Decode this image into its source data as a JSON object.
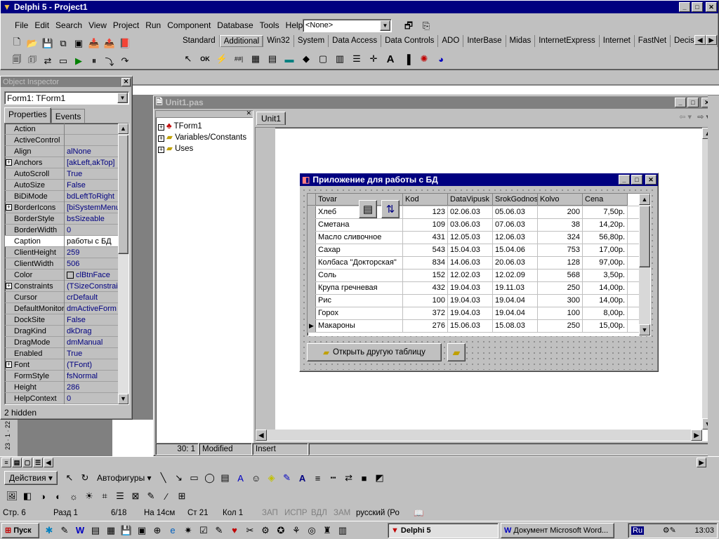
{
  "delphi": {
    "title": "Delphi 5 - Project1",
    "menu": [
      "File",
      "Edit",
      "Search",
      "View",
      "Project",
      "Run",
      "Component",
      "Database",
      "Tools",
      "Help"
    ],
    "desktop_combo": "<None>",
    "palette_tabs": [
      "Standard",
      "Additional",
      "Win32",
      "System",
      "Data Access",
      "Data Controls",
      "ADO",
      "InterBase",
      "Midas",
      "InternetExpress",
      "Internet",
      "FastNet",
      "Decision C"
    ]
  },
  "object_inspector": {
    "title": "Object Inspector",
    "object": "Form1: TForm1",
    "tabs": [
      "Properties",
      "Events"
    ],
    "rows": [
      {
        "name": "Action",
        "value": "",
        "plus": false
      },
      {
        "name": "ActiveControl",
        "value": "",
        "plus": false
      },
      {
        "name": "Align",
        "value": "alNone",
        "plus": false
      },
      {
        "name": "Anchors",
        "value": "[akLeft,akTop]",
        "plus": true
      },
      {
        "name": "AutoScroll",
        "value": "True",
        "plus": false
      },
      {
        "name": "AutoSize",
        "value": "False",
        "plus": false
      },
      {
        "name": "BiDiMode",
        "value": "bdLeftToRight",
        "plus": false
      },
      {
        "name": "BorderIcons",
        "value": "[biSystemMenu,",
        "plus": true
      },
      {
        "name": "BorderStyle",
        "value": "bsSizeable",
        "plus": false
      },
      {
        "name": "BorderWidth",
        "value": "0",
        "plus": false
      },
      {
        "name": "Caption",
        "value": "работы с БД",
        "plus": false,
        "selected": true
      },
      {
        "name": "ClientHeight",
        "value": "259",
        "plus": false
      },
      {
        "name": "ClientWidth",
        "value": "506",
        "plus": false
      },
      {
        "name": "Color",
        "value": "clBtnFace",
        "plus": false
      },
      {
        "name": "Constraints",
        "value": "(TSizeConstrain",
        "plus": true
      },
      {
        "name": "Cursor",
        "value": "crDefault",
        "plus": false
      },
      {
        "name": "DefaultMonitor",
        "value": "dmActiveForm",
        "plus": false
      },
      {
        "name": "DockSite",
        "value": "False",
        "plus": false
      },
      {
        "name": "DragKind",
        "value": "dkDrag",
        "plus": false
      },
      {
        "name": "DragMode",
        "value": "dmManual",
        "plus": false
      },
      {
        "name": "Enabled",
        "value": "True",
        "plus": false
      },
      {
        "name": "Font",
        "value": "(TFont)",
        "plus": true
      },
      {
        "name": "FormStyle",
        "value": "fsNormal",
        "plus": false
      },
      {
        "name": "Height",
        "value": "286",
        "plus": false
      },
      {
        "name": "HelpContext",
        "value": "0",
        "plus": false
      }
    ],
    "status": "2 hidden"
  },
  "editor": {
    "title": "Unit1.pas",
    "tab": "Unit1",
    "tree": [
      "TForm1",
      "Variables/Constants",
      "Uses"
    ],
    "pos": "30:   1",
    "modified": "Modified",
    "insert": "Insert"
  },
  "form": {
    "title": "Приложение для работы с БД",
    "columns": [
      "Tovar",
      "Kod",
      "DataVipusk",
      "SrokGodnos",
      "Kolvo",
      "Cena"
    ],
    "rows": [
      [
        "Хлеб",
        "123",
        "02.06.03",
        "05.06.03",
        "200",
        "7,50р."
      ],
      [
        "Сметана",
        "109",
        "03.06.03",
        "07.06.03",
        "38",
        "14,20р."
      ],
      [
        "Масло сливочное",
        "431",
        "12.05.03",
        "12.06.03",
        "324",
        "56,80р."
      ],
      [
        "Сахар",
        "543",
        "15.04.03",
        "15.04.06",
        "753",
        "17,00р."
      ],
      [
        "Колбаса \"Докторская\"",
        "834",
        "14.06.03",
        "20.06.03",
        "128",
        "97,00р."
      ],
      [
        "Соль",
        "152",
        "12.02.03",
        "12.02.09",
        "568",
        "3,50р."
      ],
      [
        "Крупа гречневая",
        "432",
        "19.04.03",
        "19.11.03",
        "250",
        "14,00р."
      ],
      [
        "Рис",
        "100",
        "19.04.03",
        "19.04.04",
        "300",
        "14,00р."
      ],
      [
        "Горох",
        "372",
        "19.04.03",
        "19.04.04",
        "100",
        "8,00р."
      ],
      [
        "Макароны",
        "276",
        "15.06.03",
        "15.08.03",
        "250",
        "15,00р."
      ]
    ],
    "open_button": "Открыть другую таблицу"
  },
  "word": {
    "draw_label": "Действия",
    "autoshapes_label": "Автофигуры",
    "status": [
      "Стр. 6",
      "Разд 1",
      "6/18",
      "На 14см",
      "Ст 21",
      "Кол 1",
      "ЗАП",
      "ИСПР",
      "ВДЛ",
      "ЗАМ",
      "русский (Ро"
    ],
    "ruler_numbers": [
      "22",
      "1",
      "23"
    ]
  },
  "taskbar": {
    "start": "Пуск",
    "tasks": [
      "Delphi 5",
      "Документ Microsoft Word..."
    ],
    "lang": "Ru",
    "clock": "13:03"
  }
}
